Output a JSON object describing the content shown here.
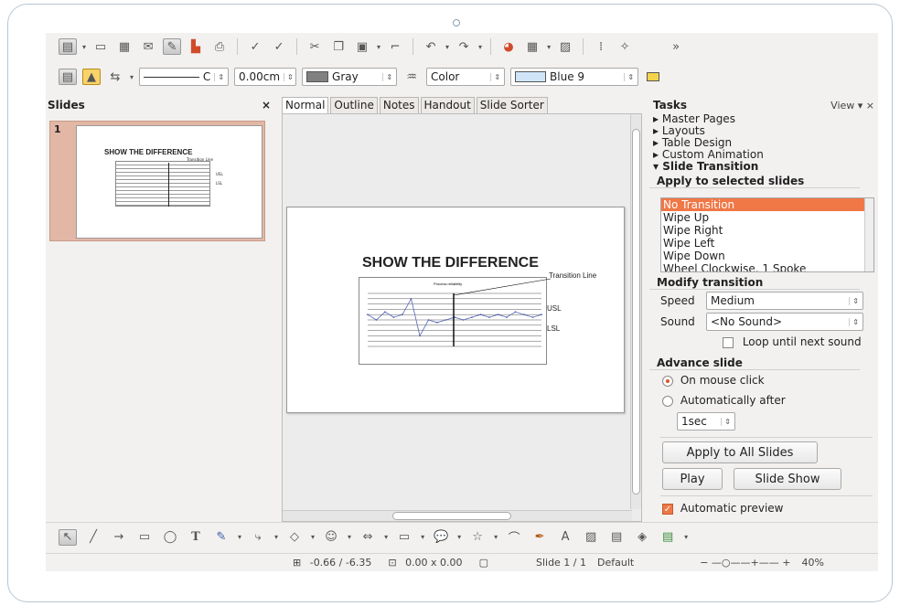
{
  "toolbar": {
    "line_width": "0.00cm",
    "area_color": "Gray",
    "fill_style": "Color",
    "fill_color": "Blue 9",
    "line_label": "C"
  },
  "slides_pane": {
    "title": "Slides",
    "close": "×",
    "slide_number": "1"
  },
  "main": {
    "tabs": [
      "Normal",
      "Outline",
      "Notes",
      "Handout",
      "Slide Sorter"
    ],
    "slide": {
      "title": "SHOW THE DIFFERENCE",
      "chart_title": "Process reliability",
      "annotation": "Transition Line",
      "usl": "USL",
      "lsl": "LSL"
    }
  },
  "chart_data": {
    "type": "line",
    "title": "Process reliability",
    "series": [
      {
        "name": "",
        "values": [
          6,
          5,
          6.5,
          5.5,
          6,
          9,
          2,
          5,
          4.5,
          5,
          5.5,
          5,
          5.5,
          6,
          5.5,
          6,
          5.5,
          6.5,
          6,
          5.5,
          6
        ]
      }
    ],
    "ylim": [
      0,
      10
    ],
    "grid": true,
    "annotations": [
      "Transition Line",
      "USL",
      "LSL"
    ]
  },
  "tasks": {
    "title": "Tasks",
    "view": "View",
    "sections": [
      "Master Pages",
      "Layouts",
      "Table Design",
      "Custom Animation"
    ],
    "open_section": "Slide Transition",
    "apply_heading": "Apply to selected slides",
    "transitions": [
      "No Transition",
      "Wipe Up",
      "Wipe Right",
      "Wipe Left",
      "Wipe Down",
      "Wheel Clockwise, 1 Spoke"
    ],
    "modify_heading": "Modify transition",
    "speed_label": "Speed",
    "speed_value": "Medium",
    "sound_label": "Sound",
    "sound_value": "<No Sound>",
    "loop_label": "Loop until next sound",
    "advance_heading": "Advance slide",
    "on_click": "On mouse click",
    "auto_after": "Automatically after",
    "auto_time": "1sec",
    "apply_all": "Apply to All Slides",
    "play": "Play",
    "slide_show": "Slide Show",
    "auto_preview": "Automatic preview"
  },
  "status": {
    "position": "-0.66 / -6.35",
    "size": "0.00 x 0.00",
    "slide": "Slide 1 / 1",
    "layout": "Default",
    "zoom": "40%"
  }
}
